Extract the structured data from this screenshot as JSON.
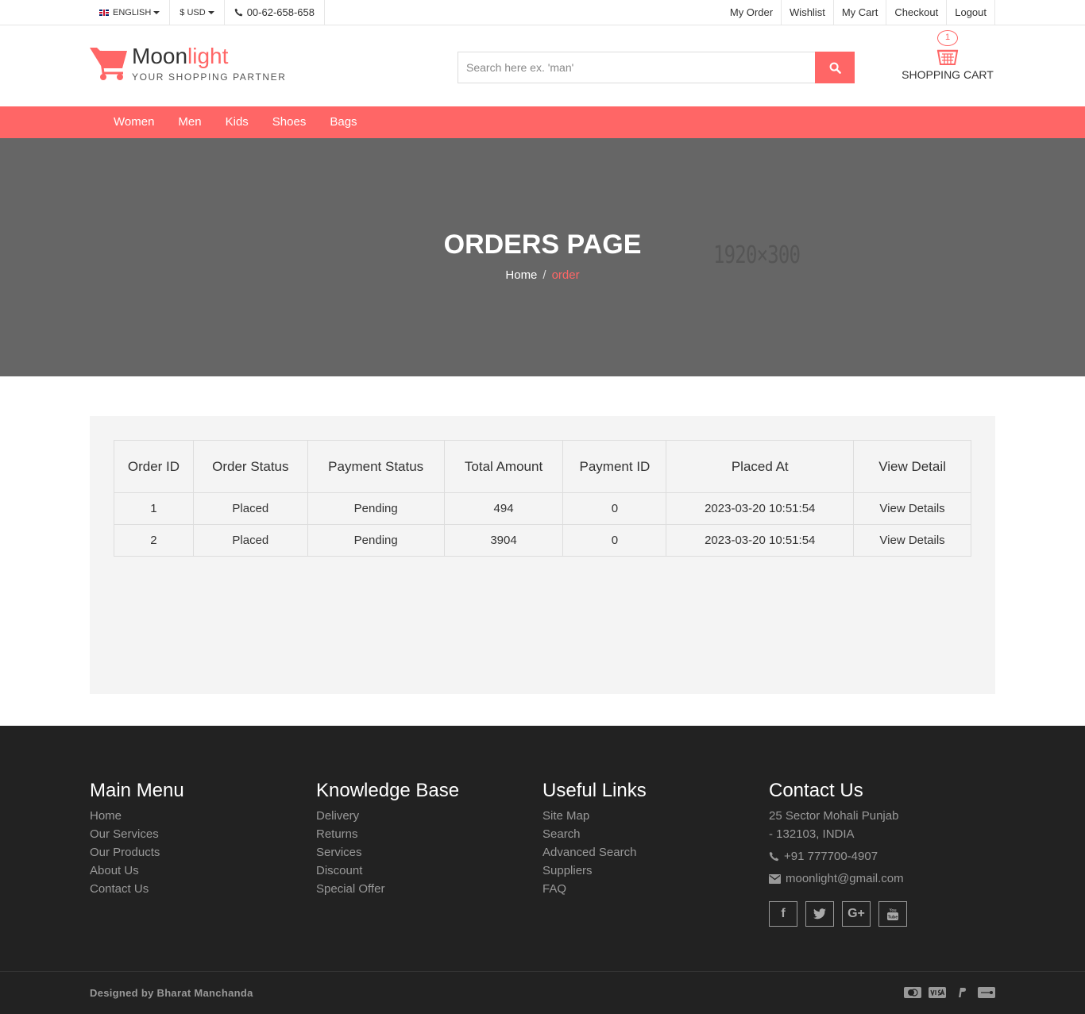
{
  "topbar": {
    "language": "ENGLISH",
    "currency": "$ USD",
    "phone": "00-62-658-658",
    "links": [
      "My Order",
      "Wishlist",
      "My Cart",
      "Checkout",
      "Logout"
    ]
  },
  "header": {
    "logo_main": "Moon",
    "logo_accent": "light",
    "tagline": "YOUR SHOPPING PARTNER",
    "search_placeholder": "Search here ex. 'man'",
    "cart_count": "1",
    "cart_label": "SHOPPING CART"
  },
  "nav": [
    "Women",
    "Men",
    "Kids",
    "Shoes",
    "Bags"
  ],
  "hero": {
    "title": "ORDERS PAGE",
    "breadcrumb_home": "Home",
    "breadcrumb_sep": "/",
    "breadcrumb_current": "order",
    "placeholder_text": "1920×300"
  },
  "orders": {
    "headers": [
      "Order ID",
      "Order Status",
      "Payment Status",
      "Total Amount",
      "Payment ID",
      "Placed At",
      "View Detail"
    ],
    "rows": [
      [
        "1",
        "Placed",
        "Pending",
        "494",
        "0",
        "2023-03-20 10:51:54",
        "View Details"
      ],
      [
        "2",
        "Placed",
        "Pending",
        "3904",
        "0",
        "2023-03-20 10:51:54",
        "View Details"
      ]
    ]
  },
  "footer": {
    "main_menu": {
      "title": "Main Menu",
      "items": [
        "Home",
        "Our Services",
        "Our Products",
        "About Us",
        "Contact Us"
      ]
    },
    "knowledge": {
      "title": "Knowledge Base",
      "items": [
        "Delivery",
        "Returns",
        "Services",
        "Discount",
        "Special Offer"
      ]
    },
    "useful": {
      "title": "Useful Links",
      "items": [
        "Site Map",
        "Search",
        "Advanced Search",
        "Suppliers",
        "FAQ"
      ]
    },
    "contact": {
      "title": "Contact Us",
      "address_line1": "25 Sector Mohali Punjab",
      "address_line2": "- 132103, INDIA",
      "phone": "+91 777700-4907",
      "email": "moonlight@gmail.com"
    },
    "socials": [
      "facebook-icon",
      "twitter-icon",
      "google-plus-icon",
      "youtube-icon"
    ],
    "credit": "Designed by Bharat Manchanda",
    "payments": [
      "mastercard-icon",
      "visa-icon",
      "paypal-icon",
      "discover-icon"
    ]
  },
  "colors": {
    "accent": "#ff6666",
    "hero_bg": "#666666",
    "footer_bg": "#222222"
  }
}
